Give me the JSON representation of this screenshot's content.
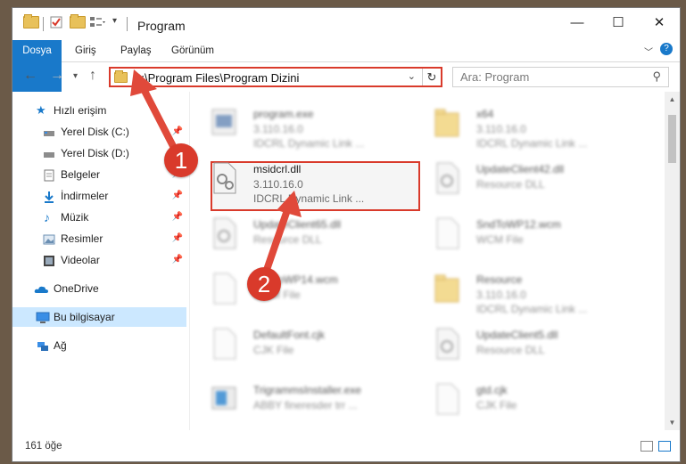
{
  "window": {
    "title": "Program"
  },
  "ribbon": {
    "tabs": [
      "Dosya",
      "Giriş",
      "Paylaş",
      "Görünüm"
    ],
    "help": "?"
  },
  "address": {
    "path": "C:\\Program Files\\Program Dizini"
  },
  "search": {
    "placeholder": "Ara: Program"
  },
  "nav": {
    "items": [
      {
        "label": "Hızlı erişim"
      },
      {
        "label": "Yerel Disk (C:)"
      },
      {
        "label": "Yerel Disk (D:)"
      },
      {
        "label": "Belgeler"
      },
      {
        "label": "İndirmeler"
      },
      {
        "label": "Müzik"
      },
      {
        "label": "Resimler"
      },
      {
        "label": "Videolar"
      },
      {
        "label": "OneDrive"
      },
      {
        "label": "Bu bilgisayar"
      },
      {
        "label": "Ağ"
      }
    ]
  },
  "files": [
    {
      "name": "program.exe",
      "line2": "3.110.16.0",
      "line3": "IDCRL Dynamic Link ..."
    },
    {
      "name": "x64",
      "line2": "3.110.16.0",
      "line3": "IDCRL Dynamic Link ..."
    },
    {
      "name": "msidcrl.dll",
      "line2": "3.110.16.0",
      "line3": "IDCRL Dynamic Link ..."
    },
    {
      "name": "UpdateClient42.dll",
      "line2": "Resource DLL",
      "line3": ""
    },
    {
      "name": "UpdateClient65.dll",
      "line2": "Resource DLL",
      "line3": ""
    },
    {
      "name": "SndToWP12.wcm",
      "line2": "WCM File",
      "line3": ""
    },
    {
      "name": "SndToWP14.wcm",
      "line2": "WCM File",
      "line3": ""
    },
    {
      "name": "Resource",
      "line2": "3.110.16.0",
      "line3": "IDCRL Dynamic Link ..."
    },
    {
      "name": "DefaultFont.cjk",
      "line2": "CJK File",
      "line3": ""
    },
    {
      "name": "UpdateClient5.dll",
      "line2": "Resource DLL",
      "line3": ""
    },
    {
      "name": "TrigrammsInstaller.exe",
      "line2": "ABBY fineresder trr ...",
      "line3": ""
    },
    {
      "name": "gtd.cjk",
      "line2": "CJK File",
      "line3": ""
    }
  ],
  "status": {
    "count": "161 öğe"
  },
  "annotations": {
    "step1": "1",
    "step2": "2"
  },
  "colors": {
    "accent": "#1979ca",
    "highlight": "#d93a2b"
  }
}
